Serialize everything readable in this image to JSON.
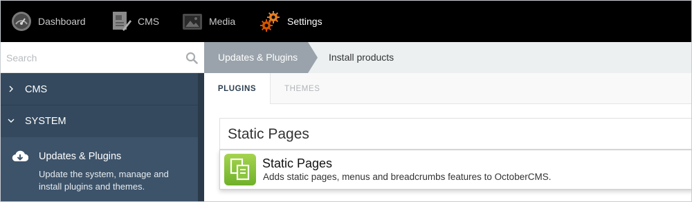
{
  "topnav": {
    "items": [
      {
        "label": "Dashboard",
        "icon": "dashboard-gauge-icon"
      },
      {
        "label": "CMS",
        "icon": "cms-document-icon"
      },
      {
        "label": "Media",
        "icon": "media-image-icon"
      },
      {
        "label": "Settings",
        "icon": "settings-gears-icon",
        "active": true
      }
    ]
  },
  "sidebar": {
    "search": {
      "placeholder": "Search",
      "value": ""
    },
    "groups": [
      {
        "label": "CMS",
        "expanded": false
      },
      {
        "label": "SYSTEM",
        "expanded": true
      }
    ],
    "selected_item": {
      "title": "Updates & Plugins",
      "description": "Update the system, manage and install plugins and themes.",
      "icon": "cloud-download-icon"
    }
  },
  "breadcrumb": {
    "items": [
      "Updates & Plugins",
      "Install products"
    ]
  },
  "tabs": {
    "items": [
      "PLUGINS",
      "THEMES"
    ],
    "active": "PLUGINS"
  },
  "main": {
    "search_value": "Static Pages",
    "results": [
      {
        "title": "Static Pages",
        "description": "Adds static pages, menus and breadcrumbs features to OctoberCMS."
      }
    ]
  },
  "colors": {
    "topbar": "#000000",
    "sidebar": "#34495e",
    "sidebar_selected": "#3d536a",
    "breadcrumb_active": "#9aa3ab",
    "settings_icon": "#e67e22",
    "plugin_logo": "#8dc63f"
  }
}
